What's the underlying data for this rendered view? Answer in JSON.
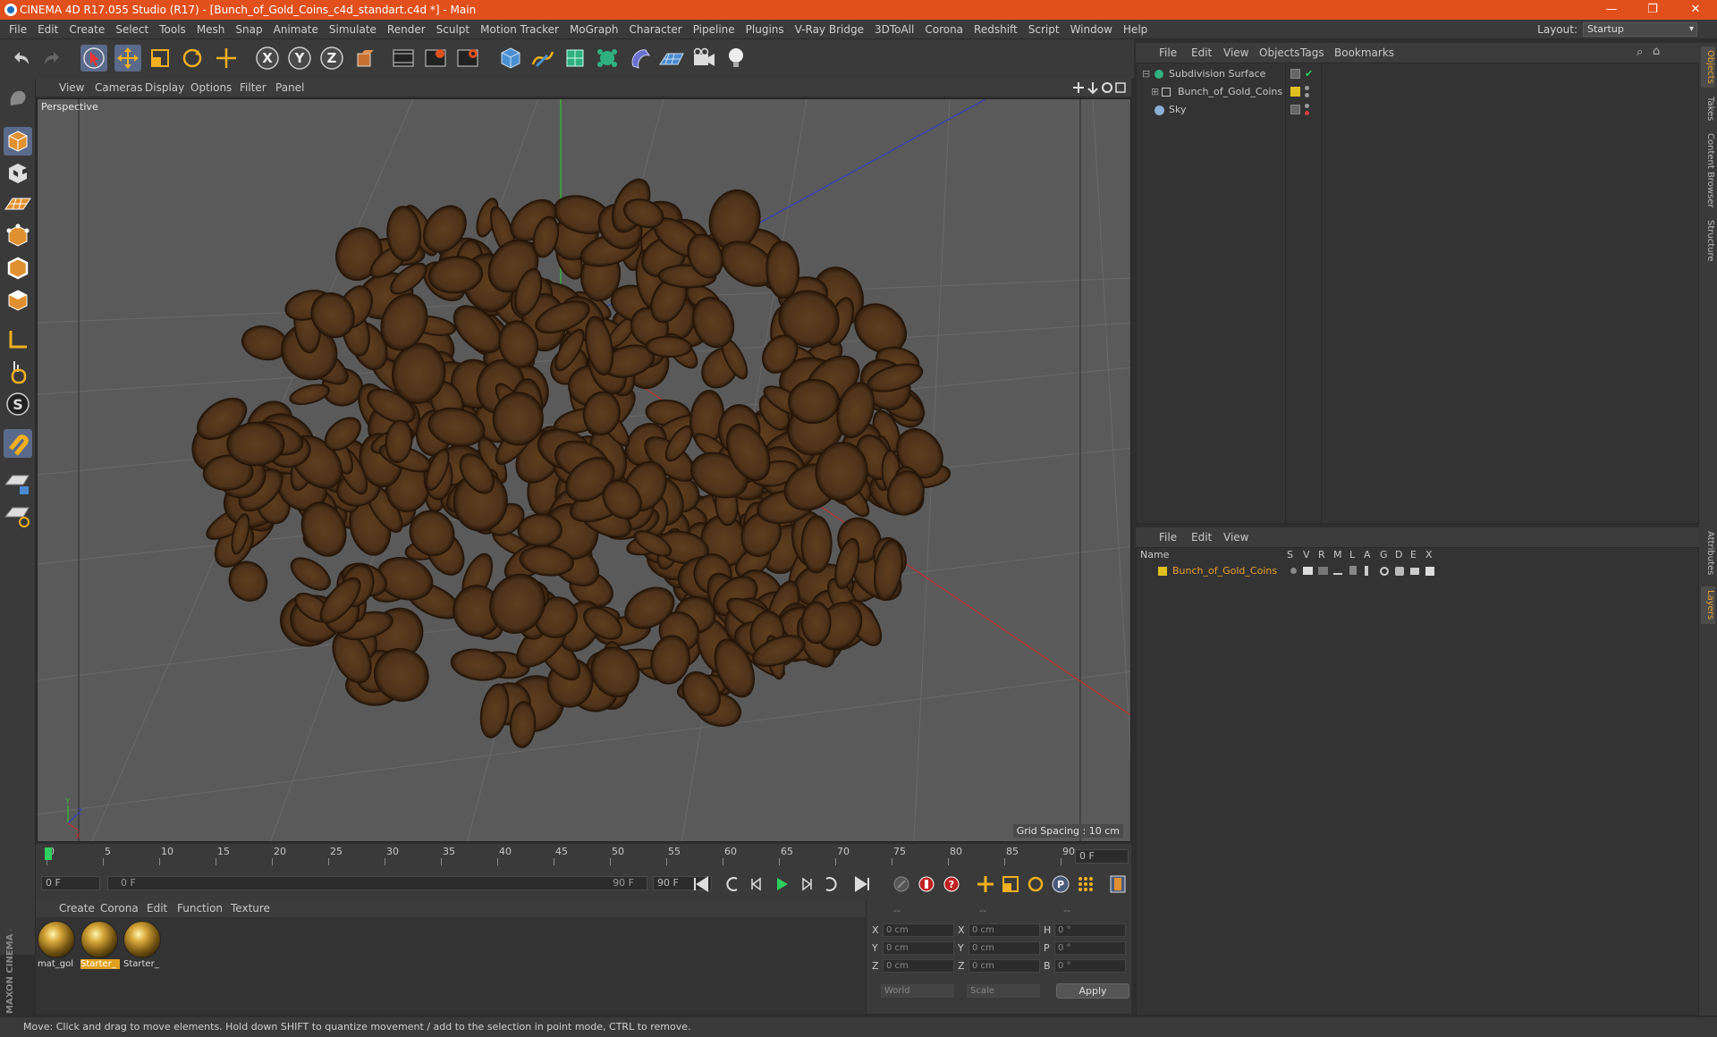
{
  "window": {
    "title": "CINEMA 4D R17.055 Studio (R17) - [Bunch_of_Gold_Coins_c4d_standart.c4d *] - Main",
    "minimize": "—",
    "restore": "❐",
    "close": "✕"
  },
  "menu": [
    "File",
    "Edit",
    "Create",
    "Select",
    "Tools",
    "Mesh",
    "Snap",
    "Animate",
    "Simulate",
    "Render",
    "Sculpt",
    "Motion Tracker",
    "MoGraph",
    "Character",
    "Pipeline",
    "Plugins",
    "V-Ray Bridge",
    "3DToAll",
    "Corona",
    "Redshift",
    "Script",
    "Window",
    "Help"
  ],
  "layout": {
    "label": "Layout:",
    "value": "Startup"
  },
  "viewport": {
    "menu": [
      "View",
      "Cameras",
      "Display",
      "Options",
      "Filter",
      "Panel"
    ],
    "label": "Perspective",
    "grid_spacing": "Grid Spacing : 10 cm",
    "axis_y": "Y",
    "axis_z": "Z",
    "axis_x": "X"
  },
  "timeline": {
    "ticks": [
      "0",
      "5",
      "10",
      "15",
      "20",
      "25",
      "30",
      "35",
      "40",
      "45",
      "50",
      "55",
      "60",
      "65",
      "70",
      "75",
      "80",
      "85",
      "90"
    ],
    "current_frame": "0 F",
    "start_frame": "0 F",
    "range_start": "0 F",
    "range_end": "90 F",
    "end_frame": "90 F"
  },
  "material_manager": {
    "menu": [
      "Create",
      "Corona",
      "Edit",
      "Function",
      "Texture"
    ],
    "materials": [
      {
        "name": "mat_gol",
        "selected": false
      },
      {
        "name": "Starter_",
        "selected": true
      },
      {
        "name": "Starter_",
        "selected": false
      }
    ]
  },
  "coordinates": {
    "header": [
      "--",
      "--",
      "--"
    ],
    "rows": [
      {
        "a": "X",
        "av": "0 cm",
        "b": "X",
        "bv": "0 cm",
        "c": "H",
        "cv": "0 °"
      },
      {
        "a": "Y",
        "av": "0 cm",
        "b": "Y",
        "bv": "0 cm",
        "c": "P",
        "cv": "0 °"
      },
      {
        "a": "Z",
        "av": "0 cm",
        "b": "Z",
        "bv": "0 cm",
        "c": "B",
        "cv": "0 °"
      }
    ],
    "world": "World",
    "scale": "Scale",
    "apply": "Apply"
  },
  "object_manager": {
    "menu": [
      "File",
      "Edit",
      "View",
      "Objects",
      "Tags",
      "Bookmarks"
    ],
    "objects": [
      {
        "name": "Subdivision Surface"
      },
      {
        "name": "Bunch_of_Gold_Coins"
      },
      {
        "name": "Sky"
      }
    ]
  },
  "layer_manager": {
    "menu": [
      "File",
      "Edit",
      "View"
    ],
    "columns": [
      "Name",
      "S",
      "V",
      "R",
      "M",
      "L",
      "A",
      "G",
      "D",
      "E",
      "X"
    ],
    "layers": [
      {
        "name": "Bunch_of_Gold_Coins",
        "color": "#e0c020"
      }
    ]
  },
  "right_tabs": [
    "Objects",
    "Takes",
    "Content Browser",
    "Structure",
    "Attributes",
    "Layers"
  ],
  "status": "Move: Click and drag to move elements. Hold down SHIFT to quantize movement / add to the selection in point mode, CTRL to remove.",
  "brand": "MAXON CINEMA 4D",
  "colors": {
    "title_bar": "#e1501c",
    "selection": "#e0a020",
    "coin": "#5a3a1c"
  }
}
